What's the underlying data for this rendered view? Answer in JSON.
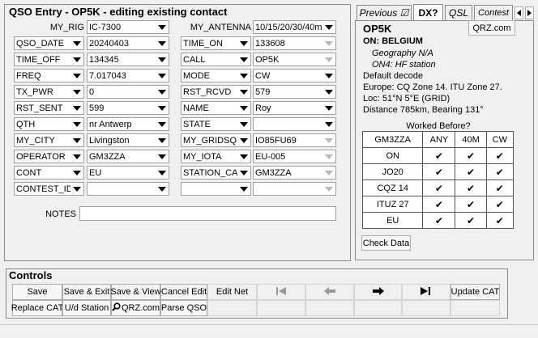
{
  "qso": {
    "title": "QSO Entry - OP5K - editing existing contact",
    "my_rig_label": "MY_RIG",
    "my_rig_value": "IC-7300",
    "my_antenna_label": "MY_ANTENNA",
    "my_antenna_value": "10/15/20/30/40m",
    "left_fields": [
      {
        "label": "QSO_DATE",
        "value": "20240403"
      },
      {
        "label": "TIME_OFF",
        "value": "134345"
      },
      {
        "label": "FREQ",
        "value": "7.017043"
      },
      {
        "label": "TX_PWR",
        "value": "0"
      },
      {
        "label": "RST_SENT",
        "value": "599"
      },
      {
        "label": "QTH",
        "value": "nr Antwerp"
      },
      {
        "label": "MY_CITY",
        "value": "Livingston"
      },
      {
        "label": "OPERATOR",
        "value": "GM3ZZA"
      },
      {
        "label": "CONT",
        "value": "EU"
      },
      {
        "label": "CONTEST_ID",
        "value": ""
      }
    ],
    "right_fields": [
      {
        "label": "TIME_ON",
        "value": "133608"
      },
      {
        "label": "CALL",
        "value": "OP5K"
      },
      {
        "label": "MODE",
        "value": "CW"
      },
      {
        "label": "RST_RCVD",
        "value": "579"
      },
      {
        "label": "NAME",
        "value": "Roy"
      },
      {
        "label": "STATE",
        "value": ""
      },
      {
        "label": "MY_GRIDSQ",
        "value": "IO85FU69"
      },
      {
        "label": "MY_IOTA",
        "value": "EU-005"
      },
      {
        "label": "STATION_CA",
        "value": "GM3ZZA"
      },
      {
        "label": "",
        "value": ""
      }
    ],
    "notes_label": "NOTES",
    "notes_value": ""
  },
  "info": {
    "tabs": [
      "Previous ☑",
      "DX?",
      "QSL",
      "Contest"
    ],
    "callsign": "OP5K",
    "qrz_button": "QRZ.com",
    "country": "ON: BELGIUM",
    "geography": "Geography N/A",
    "station_type": "ON4: HF station",
    "default_decode": "Default decode",
    "zones": "Europe: CQ Zone 14. ITU Zone 27.",
    "location": "Loc: 51°N 5°E (GRID)",
    "distance": "Distance 785km, Bearing 131°",
    "worked_before_title": "Worked Before?",
    "wb_headers": [
      "GM3ZZA",
      "ANY",
      "40M",
      "CW"
    ],
    "wb_rows": [
      "ON",
      "JO20",
      "CQZ 14",
      "ITUZ 27",
      "EU"
    ],
    "check_mark": "✔",
    "check_data_button": "Check Data"
  },
  "controls": {
    "title": "Controls",
    "row1": [
      "Save",
      "Save & Exit",
      "Save & View",
      "Cancel Edit",
      "Edit Net"
    ],
    "row1_right": "Update CAT",
    "row2": [
      "Replace CAT",
      "U/d Station",
      "QRZ.com",
      "Parse QSO"
    ]
  }
}
